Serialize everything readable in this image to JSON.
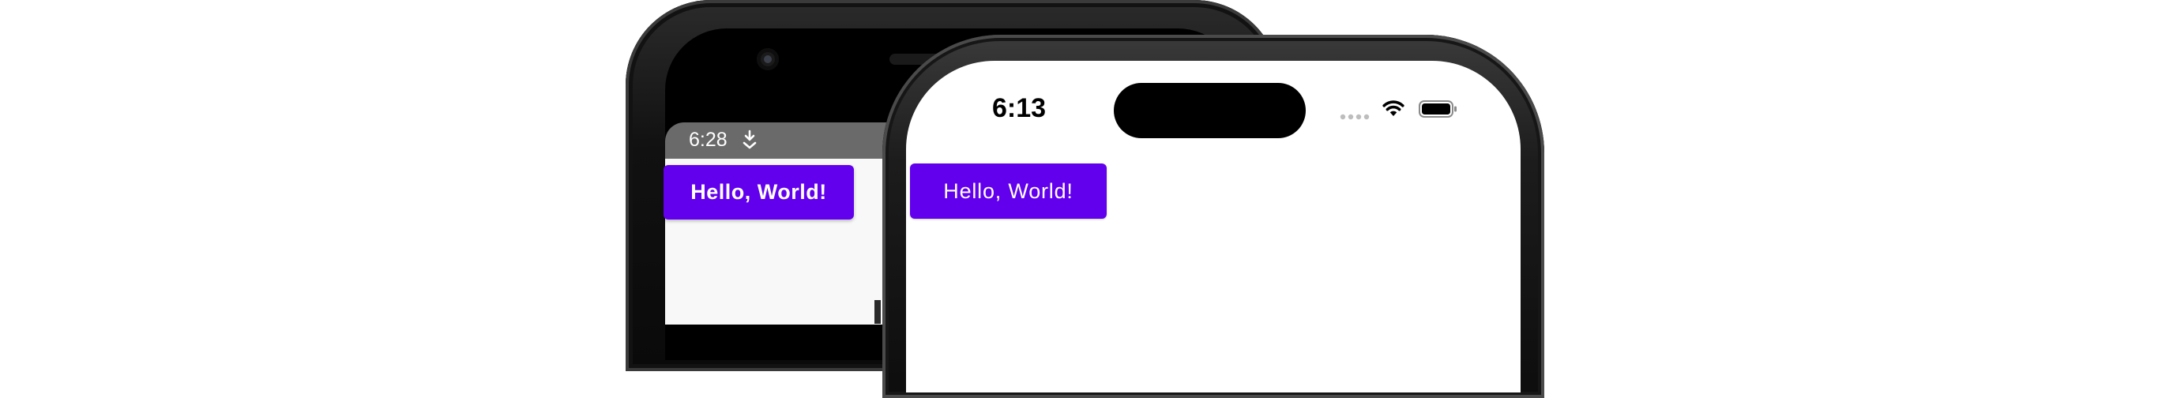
{
  "android": {
    "status_time": "6:28",
    "notification_icon": "download-notification-icon",
    "button_label": "Hello, World!",
    "colors": {
      "status_bar": "#6a6a6a",
      "button": "#6200ee",
      "content_background": "#f8f8f8"
    }
  },
  "ios": {
    "status_time": "6:13",
    "status_icons": [
      "cellular-signal-icon",
      "wifi-icon",
      "battery-icon"
    ],
    "button_label": "Hello, World!",
    "colors": {
      "button": "#6200ee",
      "screen_background": "#ffffff"
    }
  }
}
